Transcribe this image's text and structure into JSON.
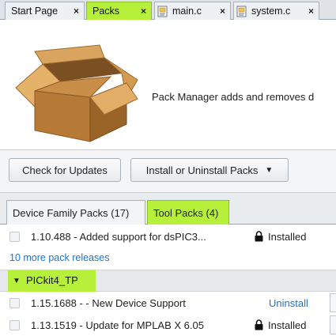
{
  "tabs": [
    {
      "label": "Start Page",
      "close": "×",
      "active": false
    },
    {
      "label": "Packs",
      "close": "×",
      "active": true
    },
    {
      "label": "main.c",
      "close": "×",
      "active": false
    },
    {
      "label": "system.c",
      "close": "×",
      "active": false
    }
  ],
  "header": {
    "description": "Pack Manager adds and removes d"
  },
  "toolbar": {
    "check_updates": "Check for Updates",
    "install_uninstall": "Install or Uninstall Packs",
    "caret": "▼"
  },
  "subtabs": [
    {
      "label": "Device Family Packs (17)",
      "active": false
    },
    {
      "label": "Tool Packs (4)",
      "active": true
    }
  ],
  "list": {
    "rows_before": [
      {
        "text": "1.10.488 - Added support for dsPIC3...",
        "status": "Installed"
      }
    ],
    "more_link": "10 more pack releases",
    "group": {
      "label": "PICkit4_TP",
      "expanded": true,
      "triangle": "▼"
    },
    "rows_after": [
      {
        "text": "1.15.1688 - - New Device Support",
        "action": "Uninstall"
      },
      {
        "text": "1.13.1519 - Update for MPLAB X 6.05",
        "status": "Installed"
      }
    ]
  },
  "colors": {
    "highlight": "#b7f03a",
    "link": "#1f73c4"
  }
}
